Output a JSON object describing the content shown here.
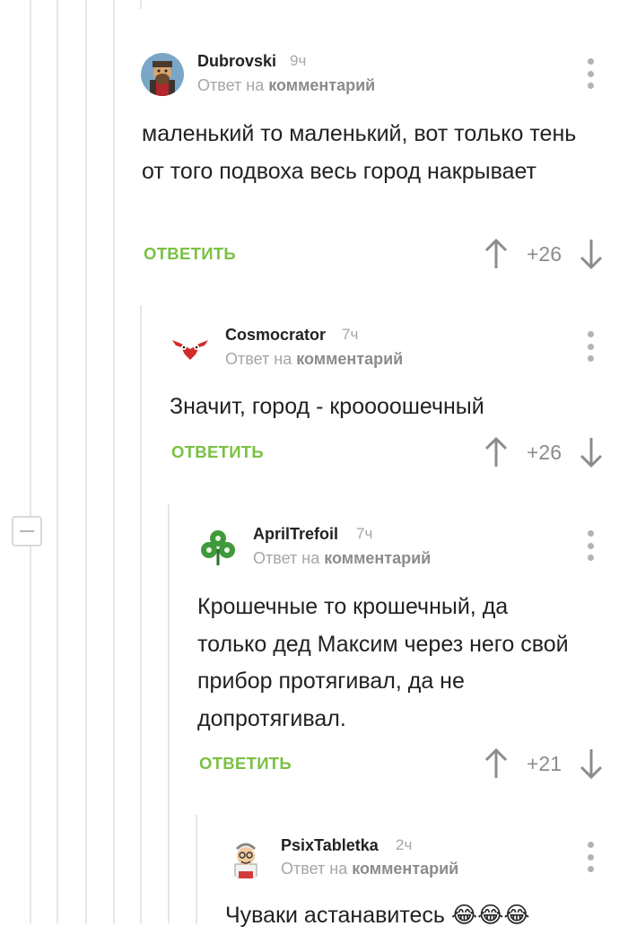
{
  "reply_to_prefix": "Ответ на",
  "reply_to_link": "комментарий",
  "reply_label": "ОТВЕТИТЬ",
  "comments": [
    {
      "user": "Dubrovski",
      "time": "9ч",
      "avatar_icon": "bearded-man-avatar",
      "text": "маленький то маленький, вот только тень от того подвоха весь город накрывает",
      "rating": "+26"
    },
    {
      "user": "Cosmocrator",
      "time": "7ч",
      "avatar_icon": "red-owl-avatar",
      "text": "Значит, город - кроооошечный",
      "rating": "+26"
    },
    {
      "user": "AprilTrefoil",
      "time": "7ч",
      "avatar_icon": "green-trefoil-avatar",
      "text": "Крошечные то крошечный, да только дед Максим через него свой прибор протягивал, да не допротягивал.",
      "rating": "+21"
    },
    {
      "user": "PsixTabletka",
      "time": "2ч",
      "avatar_icon": "cartoon-doctor-avatar",
      "text": "Чуваки астанавитесь 😂😂😂"
    }
  ],
  "colors": {
    "accent_green": "#7ac142",
    "muted": "#a6a6a6",
    "thread_line": "#e6e6e6"
  }
}
